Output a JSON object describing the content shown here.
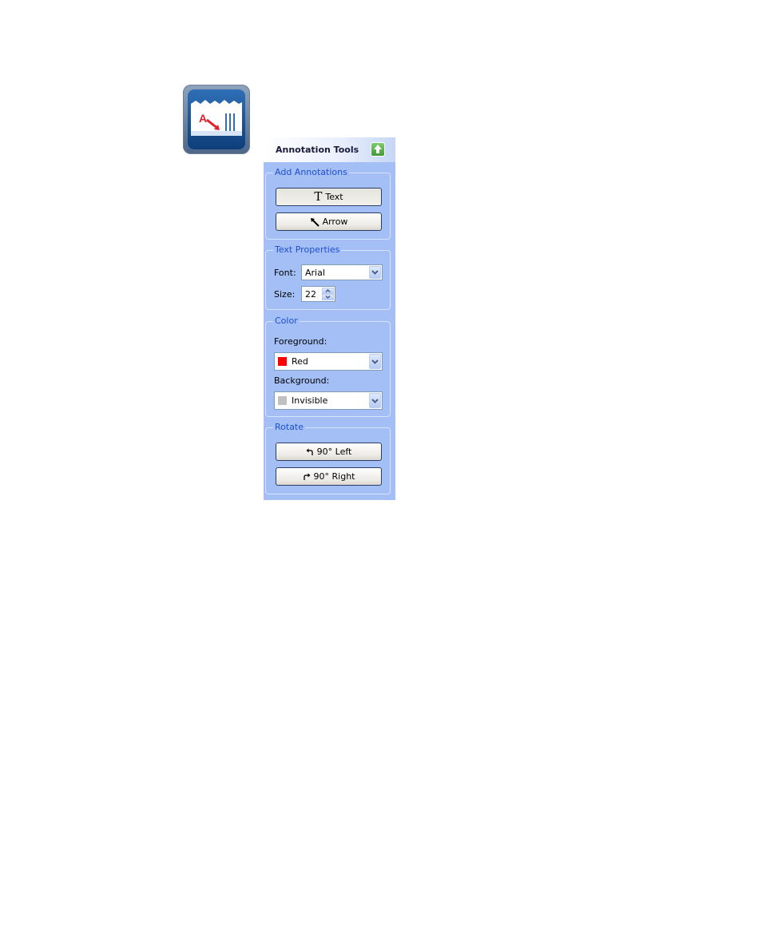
{
  "panel": {
    "title": "Annotation Tools",
    "collapse_icon": "up-arrow-icon"
  },
  "add_annotations": {
    "legend": "Add Annotations",
    "text_label": "Text",
    "arrow_label": "Arrow"
  },
  "text_properties": {
    "legend": "Text Properties",
    "font_label": "Font:",
    "font_value": "Arial",
    "size_label": "Size:",
    "size_value": "22"
  },
  "color": {
    "legend": "Color",
    "foreground_label": "Foreground:",
    "foreground_value": "Red",
    "foreground_color": "#ff0000",
    "background_label": "Background:",
    "background_value": "Invisible",
    "background_color": "#c0c0c0"
  },
  "rotate": {
    "legend": "Rotate",
    "left_label": "90° Left",
    "right_label": "90° Right"
  },
  "colors": {
    "panel_bg": "#a3bff5",
    "legend_text": "#1f4fd1",
    "collapse_green": "#4aa83c"
  }
}
